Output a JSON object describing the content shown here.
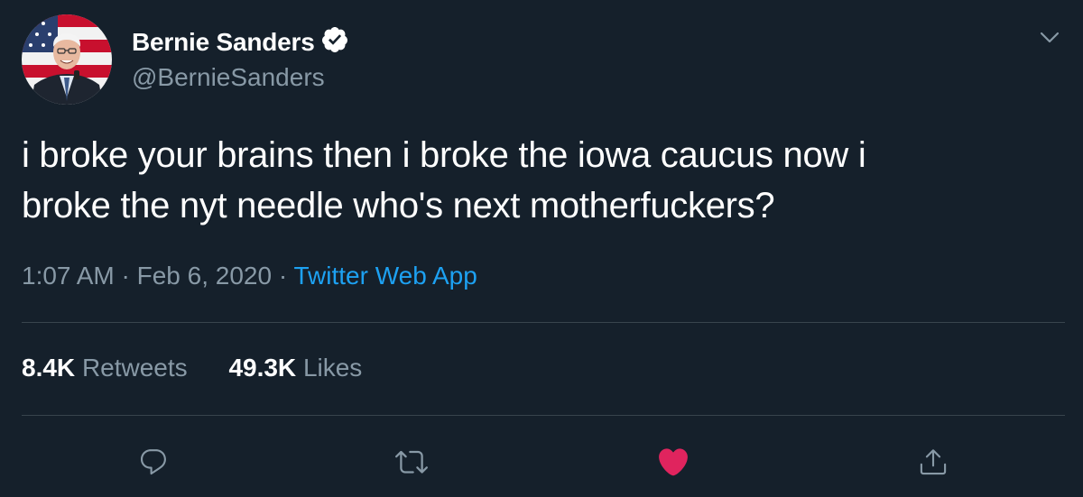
{
  "user": {
    "display_name": "Bernie Sanders",
    "handle": "@BernieSanders",
    "verified": true
  },
  "tweet": {
    "text_line1": "i broke your brains then i broke the iowa caucus now i",
    "text_line2": "broke the nyt needle who's next motherfuckers?",
    "time": "1:07 AM",
    "date": "Feb 6, 2020",
    "source": "Twitter Web App"
  },
  "stats": {
    "retweets_count": "8.4K",
    "retweets_label": "Retweets",
    "likes_count": "49.3K",
    "likes_label": "Likes"
  },
  "colors": {
    "background": "#15202b",
    "secondary_text": "#8899a6",
    "link": "#1da1f2",
    "like": "#e0245e",
    "divider": "#38444d"
  },
  "icons": {
    "verified": "verified-badge-icon",
    "menu": "chevron-down-icon",
    "reply": "reply-icon",
    "retweet": "retweet-icon",
    "like": "heart-icon",
    "share": "share-icon"
  }
}
